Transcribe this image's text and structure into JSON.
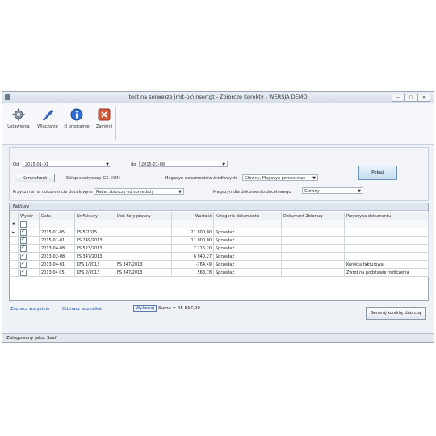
{
  "window": {
    "title": "test na serwerze jmit-pc\\insertgt - Zbiorcze Korekty - WERSJA DEMO"
  },
  "toolbar": {
    "items": [
      {
        "label": "Ustawienia",
        "icon": "gear-icon"
      },
      {
        "label": "Włączanie",
        "icon": "feather-icon"
      },
      {
        "label": "O programie",
        "icon": "info-icon"
      },
      {
        "label": "Zamknij",
        "icon": "exit-icon"
      }
    ]
  },
  "filters": {
    "od_label": "Od",
    "od_value": "2015-01-01",
    "do_label": "do",
    "do_value": "2015-01-08",
    "kontrahent_button": "Kontrahent",
    "kontrahent_text": "Sklep spożywczy GS-COM",
    "magazyn_zrodlowy_label": "Magazyn dokumentów źródłowych",
    "magazyn_zrodlowy_value": "Główny, Magazyn pomocniczy",
    "pokaz_button": "Pokaż",
    "przyczyna_label": "Przyczyna na dokumencie docelowym",
    "przyczyna_value": "Rabat zbiorczy od sprzedaży",
    "magazyn_docelowy_label": "Magazyn dla dokumentu docelowego",
    "magazyn_docelowy_value": "Główny"
  },
  "grid": {
    "caption": "Faktury",
    "columns": [
      "",
      "Wybór",
      "Data",
      "Nr Faktury",
      "Dok Korygowany",
      "Wartość",
      "Kategoria dokumentu",
      "Dokument Zbiorczy",
      "Przyczyna dokumentu"
    ],
    "rows": [
      {
        "ind": "►",
        "checked": true,
        "data": "2015-01-05",
        "nr": "FS 5/2015",
        "dok": "",
        "wartosc": "21 800,00",
        "kategoria": "Sprzedaż",
        "zbiorczy": "",
        "przyczyna": ""
      },
      {
        "ind": "",
        "checked": true,
        "data": "2015-01-01",
        "nr": "FS 249/2013",
        "dok": "",
        "wartosc": "11 000,00",
        "kategoria": "Sprzedaż",
        "zbiorczy": "",
        "przyczyna": ""
      },
      {
        "ind": "",
        "checked": true,
        "data": "2013-04-08",
        "nr": "FS 523/2013",
        "dok": "",
        "wartosc": "7 216,20",
        "kategoria": "Sprzedaż",
        "zbiorczy": "",
        "przyczyna": ""
      },
      {
        "ind": "",
        "checked": true,
        "data": "2013-02-08",
        "nr": "FS 347/2013",
        "dok": "",
        "wartosc": "6 940,27",
        "kategoria": "Sprzedaż",
        "zbiorczy": "",
        "przyczyna": ""
      },
      {
        "ind": "",
        "checked": true,
        "data": "2013-04-01",
        "nr": "KFS 1/2013",
        "dok": "FS 347/2013",
        "wartosc": "-764,49",
        "kategoria": "Sprzedaż",
        "zbiorczy": "",
        "przyczyna": "Korekta fakturowa"
      },
      {
        "ind": "",
        "checked": true,
        "data": "2013 04 05",
        "nr": "KFS 2/2013",
        "dok": "FS 347/2013",
        "wartosc": "568,78",
        "kategoria": "Sprzedaż",
        "zbiorczy": "",
        "przyczyna": "Zwrot na podstawie rozliczenia"
      }
    ]
  },
  "footer": {
    "zaznacz_wszystkie": "Zaznacz wszystkie",
    "odznacz_wszystkie": "Odznacz wszystkie",
    "wykonaj": "Wykonaj",
    "suma": "Suma = 45 817,00",
    "generuj_button": "Generuj korektę zbiorczą"
  },
  "status": {
    "text": "Zalogowany jako: Szef"
  }
}
